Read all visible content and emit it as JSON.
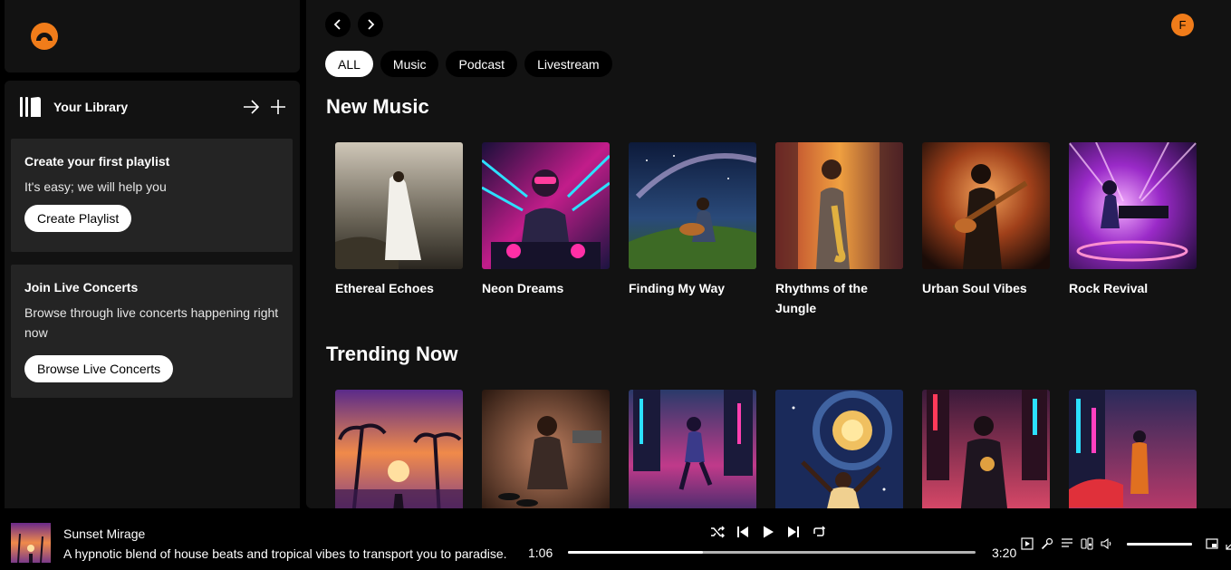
{
  "sidebar": {
    "library_title": "Your Library",
    "cards": [
      {
        "title": "Create your first playlist",
        "text": "It's easy; we will help you",
        "button": "Create Playlist"
      },
      {
        "title": "Join Live Concerts",
        "text": "Browse through live concerts happening right now",
        "button": "Browse Live Concerts"
      }
    ]
  },
  "header": {
    "avatar_initial": "F"
  },
  "filters": [
    "ALL",
    "Music",
    "Podcast",
    "Livestream"
  ],
  "sections": [
    {
      "title": "New Music",
      "items": [
        "Ethereal Echoes",
        "Neon Dreams",
        "Finding My Way",
        "Rhythms of the Jungle",
        "Urban Soul Vibes",
        "Rock Revival"
      ]
    },
    {
      "title": "Trending Now"
    }
  ],
  "player": {
    "title": "Sunset Mirage",
    "description": "A hypnotic blend of house beats and tropical vibes to transport you to paradise.",
    "elapsed": "1:06",
    "duration": "3:20",
    "progress_fraction": 0.33,
    "volume_fraction": 1.0
  },
  "colors": {
    "accent": "#f07c1a",
    "background": "#000000",
    "panel": "#121212",
    "card": "#242424"
  }
}
